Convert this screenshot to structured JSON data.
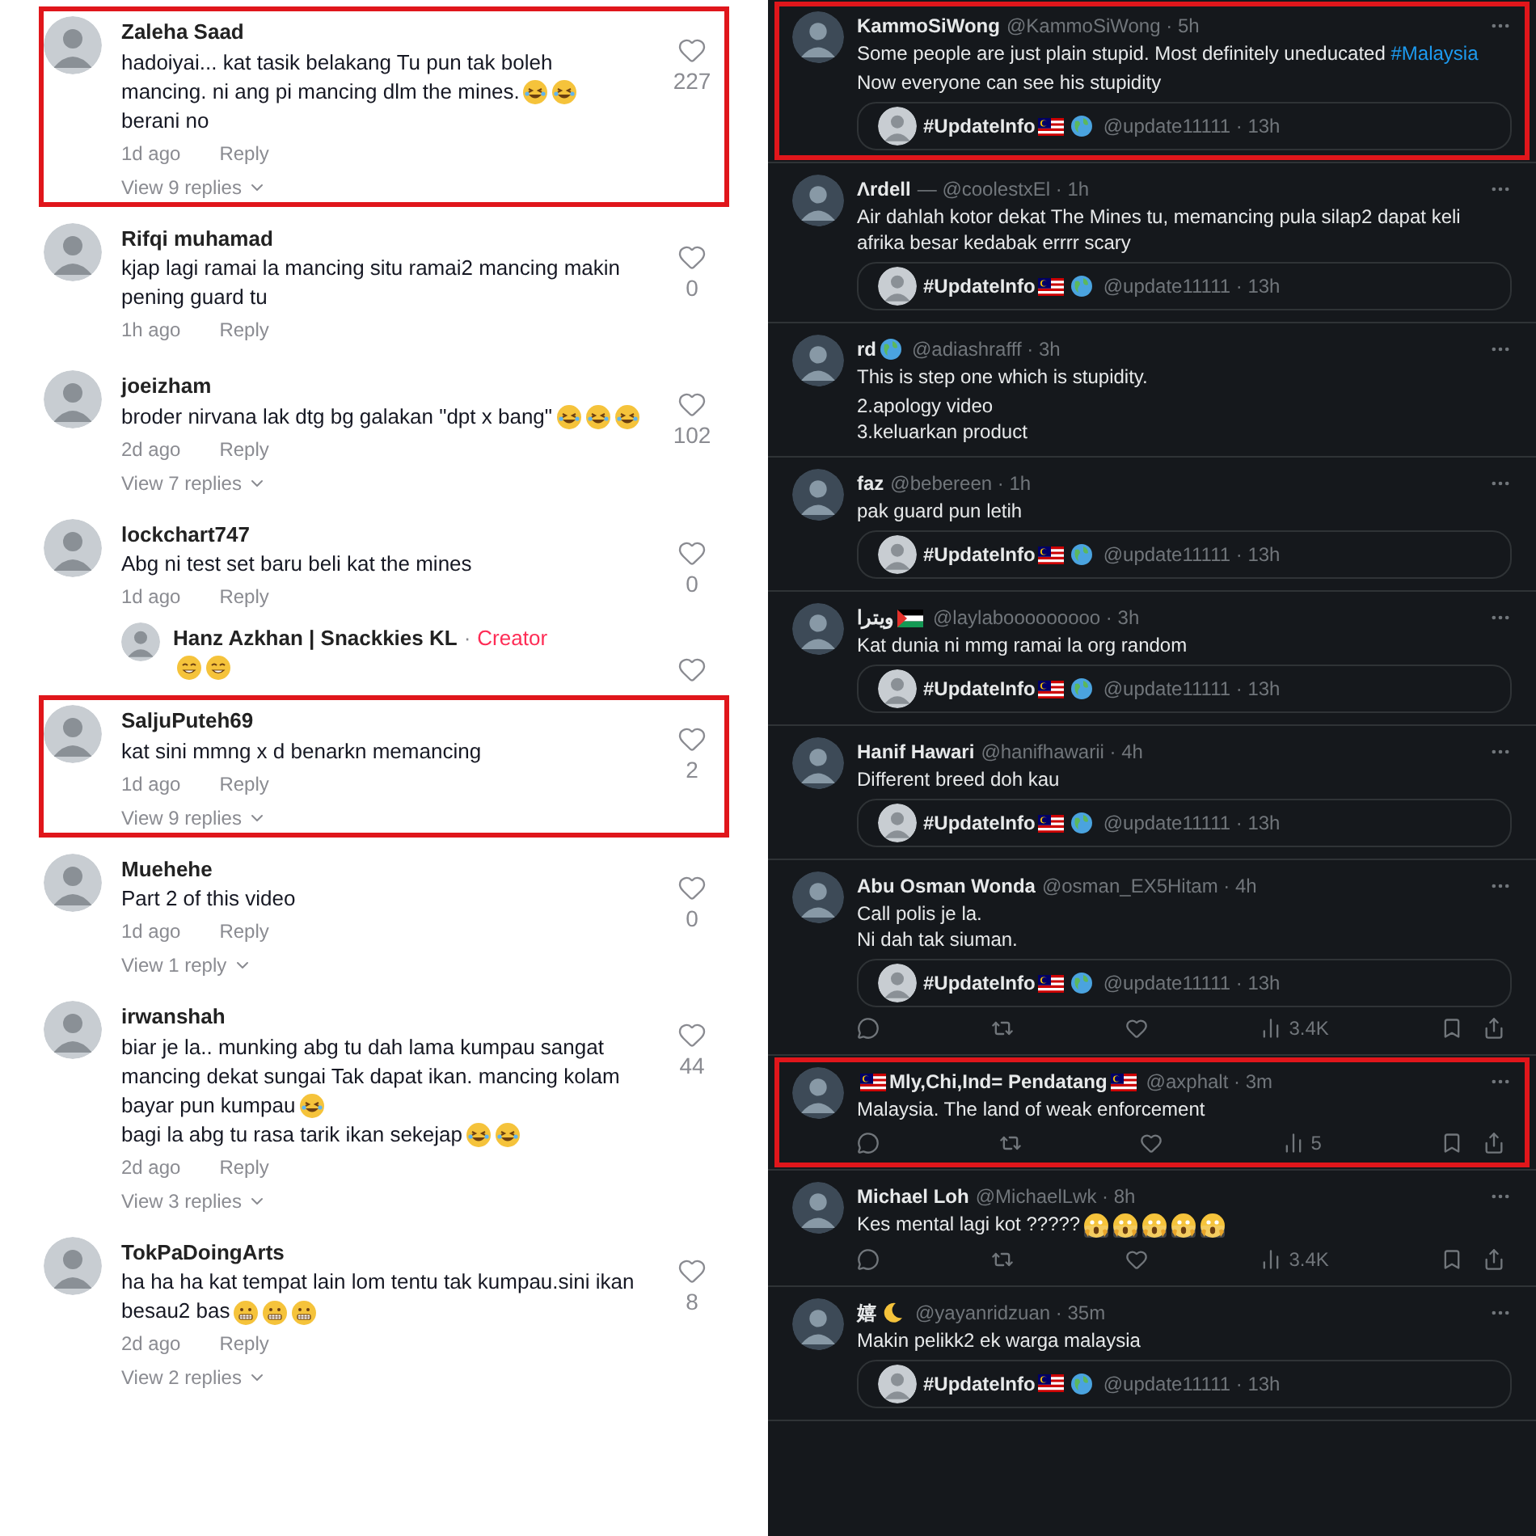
{
  "comments": [
    {
      "name": "Zaleha Saad",
      "paragraphs": [
        {
          "text": "hadoiyai... kat tasik belakang Tu pun tak boleh mancing. ni ang pi mancing dlm the mines.",
          "emojis": [
            {
              "kind": "laugh"
            },
            {
              "kind": "laugh"
            }
          ]
        },
        {
          "text": "berani no"
        }
      ],
      "time": "1d ago",
      "reply_label": "Reply",
      "likes": "227",
      "view_replies": "View 9 replies",
      "highlighted": true
    },
    {
      "name": "Rifqi muhamad",
      "paragraphs": [
        {
          "text": "kjap lagi ramai la mancing situ ramai2 mancing makin pening guard tu"
        }
      ],
      "time": "1h ago",
      "reply_label": "Reply",
      "likes": "0",
      "highlighted": false
    },
    {
      "name": "joeizham",
      "paragraphs": [
        {
          "text": "broder nirvana lak dtg bg galakan \"dpt x bang\"",
          "emojis": [
            {
              "kind": "laugh"
            },
            {
              "kind": "laugh"
            },
            {
              "kind": "laugh"
            }
          ]
        }
      ],
      "time": "2d ago",
      "reply_label": "Reply",
      "likes": "102",
      "view_replies": "View 7 replies",
      "highlighted": false
    },
    {
      "name": "lockchart747",
      "paragraphs": [
        {
          "text": "Abg ni test set baru beli kat the mines"
        }
      ],
      "time": "1d ago",
      "reply_label": "Reply",
      "likes": "0",
      "highlighted": false,
      "replies": [
        {
          "name": "Hanz Azkhan | Snackkies KL",
          "separator": "·",
          "badge": "Creator",
          "emojis": [
            {
              "kind": "grin"
            },
            {
              "kind": "grin"
            }
          ]
        }
      ]
    },
    {
      "name": "SaljuPuteh69",
      "paragraphs": [
        {
          "text": "kat sini mmng x d benarkn memancing"
        }
      ],
      "time": "1d ago",
      "reply_label": "Reply",
      "likes": "2",
      "view_replies": "View 9 replies",
      "highlighted": true
    },
    {
      "name": "Muehehe",
      "paragraphs": [
        {
          "text": "Part 2 of this video"
        }
      ],
      "time": "1d ago",
      "reply_label": "Reply",
      "likes": "0",
      "view_replies": "View 1 reply",
      "highlighted": false
    },
    {
      "name": "irwanshah",
      "paragraphs": [
        {
          "text": "biar je la.. munking abg tu dah lama kumpau sangat mancing dekat sungai Tak dapat ikan. mancing kolam bayar pun kumpau",
          "emojis": [
            {
              "kind": "laugh"
            }
          ]
        },
        {
          "text": "bagi la abg tu rasa tarik ikan sekejap",
          "emojis": [
            {
              "kind": "laugh"
            },
            {
              "kind": "laugh"
            }
          ]
        }
      ],
      "time": "2d ago",
      "reply_label": "Reply",
      "likes": "44",
      "view_replies": "View 3 replies",
      "highlighted": false
    },
    {
      "name": "TokPaDoingArts",
      "paragraphs": [
        {
          "text": "ha ha ha kat tempat lain lom tentu tak kumpau.sini ikan besau2 bas",
          "emojis": [
            {
              "kind": "teeth"
            },
            {
              "kind": "teeth"
            },
            {
              "kind": "teeth"
            }
          ]
        }
      ],
      "time": "2d ago",
      "reply_label": "Reply",
      "likes": "8",
      "view_replies": "View 2 replies",
      "highlighted": false
    }
  ],
  "tweets": [
    {
      "name": "KammoSiWong",
      "handle_time": "@KammoSiWong · 5h",
      "paragraphs": [
        {
          "text": "Some people are just plain stupid. Most definitely uneducated",
          "link": "#Malaysia"
        },
        {
          "text": "Now everyone can see his stupidity"
        }
      ],
      "quote": {
        "name": "#UpdateInfo",
        "icons": [
          {
            "kind": "flag-my"
          },
          {
            "kind": "globe"
          }
        ],
        "handle_time": "@update11111 · 13h"
      },
      "highlighted": true
    },
    {
      "name": "Λrdell",
      "handle_time": "— @coolestxEl · 1h",
      "paragraphs": [
        {
          "text": "Air dahlah kotor dekat The Mines tu, memancing pula silap2 dapat keli afrika besar kedabak errrr scary"
        }
      ],
      "quote": {
        "name": "#UpdateInfo",
        "icons": [
          {
            "kind": "flag-my"
          },
          {
            "kind": "globe"
          }
        ],
        "handle_time": "@update11111 · 13h"
      },
      "highlighted": false
    },
    {
      "name": "rd",
      "trailing_icons": [
        {
          "kind": "globe"
        }
      ],
      "handle_time": "@adiashrafff · 3h",
      "paragraphs": [
        {
          "text": "This is step one which is stupidity."
        },
        {
          "text": "2.apology video\n3.keluarkan product"
        }
      ],
      "highlighted": false
    },
    {
      "name": "faz",
      "handle_time": "@bebereen · 1h",
      "paragraphs": [
        {
          "text": "pak guard pun letih"
        }
      ],
      "quote": {
        "name": "#UpdateInfo",
        "icons": [
          {
            "kind": "flag-my"
          },
          {
            "kind": "globe"
          }
        ],
        "handle_time": "@update11111 · 13h"
      },
      "highlighted": false
    },
    {
      "name": "ويترا",
      "trailing_icons": [
        {
          "kind": "flag-ps"
        }
      ],
      "handle_time": "@laylabooooooooo · 3h",
      "paragraphs": [
        {
          "text": "Kat dunia ni mmg ramai la org random"
        }
      ],
      "quote": {
        "name": "#UpdateInfo",
        "icons": [
          {
            "kind": "flag-my"
          },
          {
            "kind": "globe"
          }
        ],
        "handle_time": "@update11111 · 13h"
      },
      "highlighted": false
    },
    {
      "name": "Hanif Hawari",
      "handle_time": "@hanifhawarii · 4h",
      "paragraphs": [
        {
          "text": "Different breed doh kau"
        }
      ],
      "quote": {
        "name": "#UpdateInfo",
        "icons": [
          {
            "kind": "flag-my"
          },
          {
            "kind": "globe"
          }
        ],
        "handle_time": "@update11111 · 13h"
      },
      "highlighted": false
    },
    {
      "name": "Abu Osman Wonda",
      "handle_time": "@osman_EX5Hitam · 4h",
      "paragraphs": [
        {
          "text": "Call polis je la.\nNi dah tak siuman."
        }
      ],
      "quote": {
        "name": "#UpdateInfo",
        "icons": [
          {
            "kind": "flag-my"
          },
          {
            "kind": "globe"
          }
        ],
        "handle_time": "@update11111 · 13h"
      },
      "views": "3.4K",
      "highlighted": false
    },
    {
      "name": "Mly,Chi,Ind= Pendatang",
      "leading_icons": [
        {
          "kind": "flag-my"
        }
      ],
      "trailing_icons": [
        {
          "kind": "flag-my"
        }
      ],
      "handle_time": "@axphalt · 3m",
      "paragraphs": [
        {
          "text": "Malaysia. The land of weak enforcement"
        }
      ],
      "views": "5",
      "highlighted": true
    },
    {
      "name": "Michael Loh",
      "handle_time": "@MichaelLwk · 8h",
      "paragraphs": [
        {
          "text": "Kes mental lagi kot ?????",
          "emojis": [
            {
              "kind": "scream"
            },
            {
              "kind": "scream"
            },
            {
              "kind": "scream"
            },
            {
              "kind": "scream"
            },
            {
              "kind": "scream"
            }
          ]
        }
      ],
      "views": "3.4K",
      "highlighted": false
    },
    {
      "name": "嬉",
      "trailing_icons": [
        {
          "kind": "moon"
        }
      ],
      "handle_time": "@yayanridzuan · 35m",
      "paragraphs": [
        {
          "text": "Makin pelikk2 ek warga malaysia"
        }
      ],
      "quote": {
        "name": "#UpdateInfo",
        "icons": [
          {
            "kind": "flag-my"
          },
          {
            "kind": "globe"
          }
        ],
        "handle_time": "@update11111 · 13h"
      },
      "highlighted": false
    }
  ]
}
